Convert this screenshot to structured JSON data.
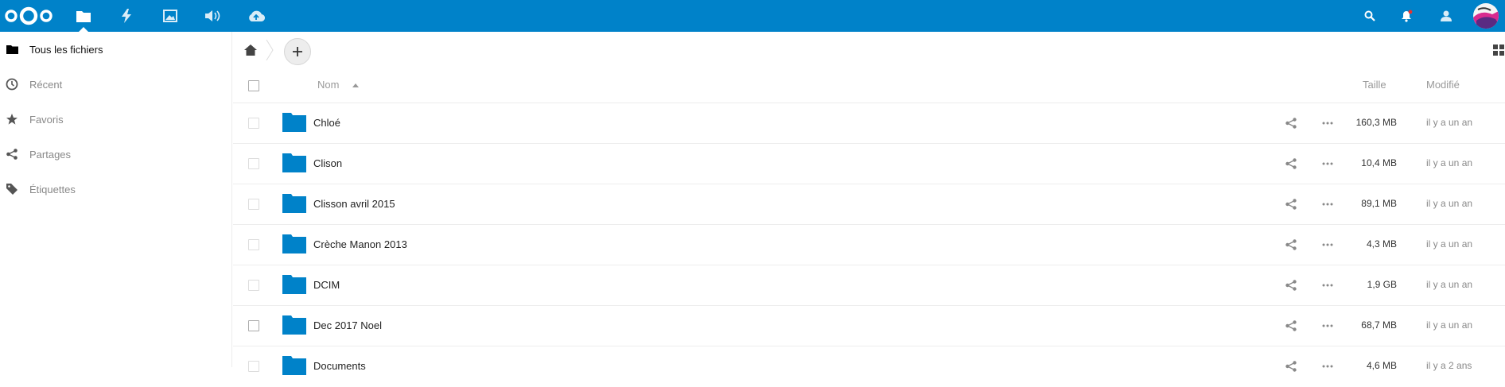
{
  "header": {
    "app_icons": [
      "nextcloud-logo",
      "files-icon",
      "activity-icon",
      "gallery-icon",
      "audio-icon",
      "cloud-upload-icon"
    ],
    "right_icons": [
      "search-icon",
      "notifications-icon",
      "contacts-icon",
      "avatar"
    ]
  },
  "colors": {
    "brand": "#0082c9",
    "folder": "#0082c9"
  },
  "sidebar": {
    "items": [
      {
        "label": "Tous les fichiers",
        "icon": "folder-icon",
        "active": true
      },
      {
        "label": "Récent",
        "icon": "clock-icon"
      },
      {
        "label": "Favoris",
        "icon": "star-icon"
      },
      {
        "label": "Partages",
        "icon": "share-icon"
      },
      {
        "label": "Étiquettes",
        "icon": "tag-icon"
      }
    ]
  },
  "table": {
    "columns": {
      "name": "Nom",
      "size": "Taille",
      "modified": "Modifié"
    },
    "rows": [
      {
        "name": "Chloé",
        "size": "160,3 MB",
        "modified": "il y a un an"
      },
      {
        "name": "Clison",
        "size": "10,4 MB",
        "modified": "il y a un an"
      },
      {
        "name": "Clisson avril 2015",
        "size": "89,1 MB",
        "modified": "il y a un an"
      },
      {
        "name": "Crèche Manon 2013",
        "size": "4,3 MB",
        "modified": "il y a un an"
      },
      {
        "name": "DCIM",
        "size": "1,9 GB",
        "modified": "il y a un an"
      },
      {
        "name": "Dec 2017 Noel",
        "size": "68,7 MB",
        "modified": "il y a un an"
      },
      {
        "name": "Documents",
        "size": "4,6 MB",
        "modified": "il y a 2 ans"
      }
    ]
  }
}
